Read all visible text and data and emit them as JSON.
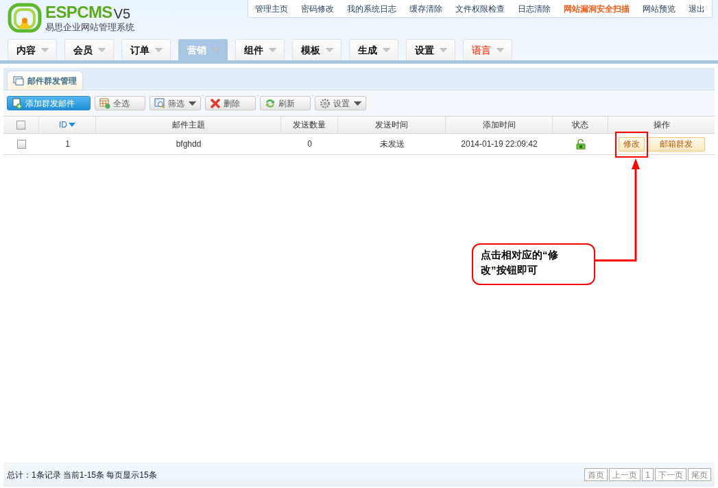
{
  "logo": {
    "brand": "ESPCMS",
    "version": "V5",
    "subtitle": "易思企业网站管理系统"
  },
  "top_links": [
    {
      "label": "管理主页",
      "highlight": false
    },
    {
      "label": "密码修改",
      "highlight": false
    },
    {
      "label": "我的系统日志",
      "highlight": false
    },
    {
      "label": "缓存清除",
      "highlight": false
    },
    {
      "label": "文件权限检查",
      "highlight": false
    },
    {
      "label": "日志清除",
      "highlight": false
    },
    {
      "label": "网站漏洞安全扫描",
      "highlight": true
    },
    {
      "label": "网站预览",
      "highlight": false
    },
    {
      "label": "退出",
      "highlight": false
    }
  ],
  "nav_tabs": [
    {
      "label": "内容",
      "selected": false,
      "highlight": false
    },
    {
      "label": "会员",
      "selected": false,
      "highlight": false
    },
    {
      "label": "订单",
      "selected": false,
      "highlight": false
    },
    {
      "label": "营销",
      "selected": true,
      "highlight": false
    },
    {
      "label": "组件",
      "selected": false,
      "highlight": false
    },
    {
      "label": "模板",
      "selected": false,
      "highlight": false
    },
    {
      "label": "生成",
      "selected": false,
      "highlight": false
    },
    {
      "label": "设置",
      "selected": false,
      "highlight": false
    },
    {
      "label": "语言",
      "selected": false,
      "highlight": true
    }
  ],
  "panel_tab": "邮件群发管理",
  "toolbar": [
    {
      "label": "添加群发邮件",
      "kind": "primary",
      "dropdown": false
    },
    {
      "label": "全选",
      "kind": "normal",
      "dropdown": false
    },
    {
      "label": "筛选",
      "kind": "normal",
      "dropdown": true
    },
    {
      "label": "删除",
      "kind": "normal",
      "dropdown": false
    },
    {
      "label": "刷新",
      "kind": "normal",
      "dropdown": false
    },
    {
      "label": "设置",
      "kind": "normal",
      "dropdown": true
    }
  ],
  "table": {
    "select_all_checked": false,
    "columns": [
      "ID",
      "邮件主题",
      "发送数量",
      "发送时间",
      "添加时间",
      "状态",
      "操作"
    ],
    "rows": [
      {
        "checked": false,
        "id": "1",
        "subject": "bfghdd",
        "count": "0",
        "send_time": "未发送",
        "add_time": "2014-01-19 22:09:42",
        "actions": [
          "修改",
          "邮箱群发"
        ]
      }
    ]
  },
  "annotation": {
    "text": "点击相对应的“修改”按钮即可"
  },
  "footer": {
    "summary": "总计：1条记录 当前1-15条 每页显示15条",
    "pager": [
      "首页",
      "上一页",
      "1",
      "下一页",
      "尾页"
    ]
  }
}
